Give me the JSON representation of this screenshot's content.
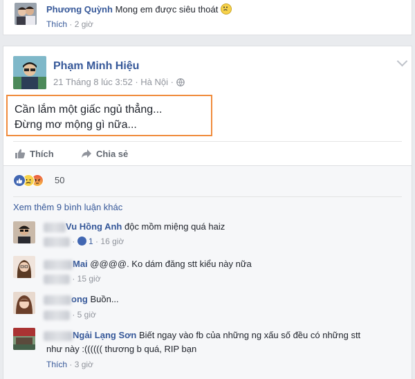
{
  "top_comment": {
    "author": "Phương Quỳnh",
    "text": "Mong em được siêu thoát",
    "like_label": "Thích",
    "time": "2 giờ"
  },
  "post": {
    "author": "Phạm Minh Hiệu",
    "date": "21 Tháng 8 lúc 3:52",
    "location": "Hà Nội",
    "line1": "Cần lắm một giấc ngủ thẳng...",
    "line2": "Đừng mơ mộng gì nữa...",
    "like_label": "Thích",
    "share_label": "Chia sẻ",
    "reaction_count": "50"
  },
  "comments": {
    "view_more": "Xem thêm 9 bình luận khác",
    "items": [
      {
        "name": "Vu Hồng Anh",
        "text": "độc mồm miệng quá haiz",
        "likes": "1",
        "time": "16 giờ"
      },
      {
        "name": "Mai",
        "text": "@@@@. Ko dám đăng stt kiểu này nữa",
        "time": "15 giờ"
      },
      {
        "name": "ong",
        "text": "Buồn...",
        "time": "5 giờ"
      },
      {
        "name": "Ngải Lạng Sơn",
        "text1": "Biết ngay vào fb của những ng xấu số đều có những stt",
        "text2": "như này :(((((( thương b quá, RIP bạn",
        "like_label": "Thích",
        "time": "3 giờ"
      }
    ]
  },
  "colors": {
    "link": "#365899",
    "meta": "#90949c",
    "highlight": "#f08b3c",
    "like_blue": "#4267b2"
  }
}
